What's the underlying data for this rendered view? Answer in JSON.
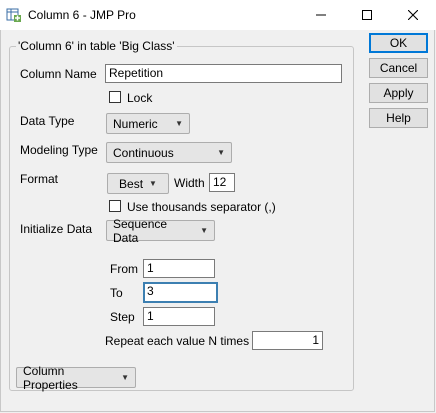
{
  "window": {
    "title": "Column 6 - JMP Pro",
    "minimize_glyph": "—",
    "maximize_glyph": "☐",
    "close_glyph": "✕"
  },
  "group": {
    "legend": "'Column 6' in table 'Big Class'"
  },
  "form": {
    "column_name_label": "Column Name",
    "column_name_value": "Repetition",
    "lock_label": "Lock",
    "data_type_label": "Data Type",
    "data_type_value": "Numeric",
    "modeling_type_label": "Modeling Type",
    "modeling_type_value": "Continuous",
    "format_label": "Format",
    "format_value": "Best",
    "width_label": "Width",
    "width_value": "12",
    "thousands_label": "Use thousands separator (,)",
    "initialize_label": "Initialize Data",
    "initialize_value": "Sequence Data",
    "from_label": "From",
    "from_value": "1",
    "to_label": "To",
    "to_value": "3",
    "step_label": "Step",
    "step_value": "1",
    "repeat_label": "Repeat each value N times",
    "repeat_value": "1",
    "column_properties_label": "Column Properties"
  },
  "buttons": {
    "ok": "OK",
    "cancel": "Cancel",
    "apply": "Apply",
    "help": "Help"
  },
  "colors": {
    "focus": "#3c7fb1",
    "default_button_border": "#0078d7"
  }
}
